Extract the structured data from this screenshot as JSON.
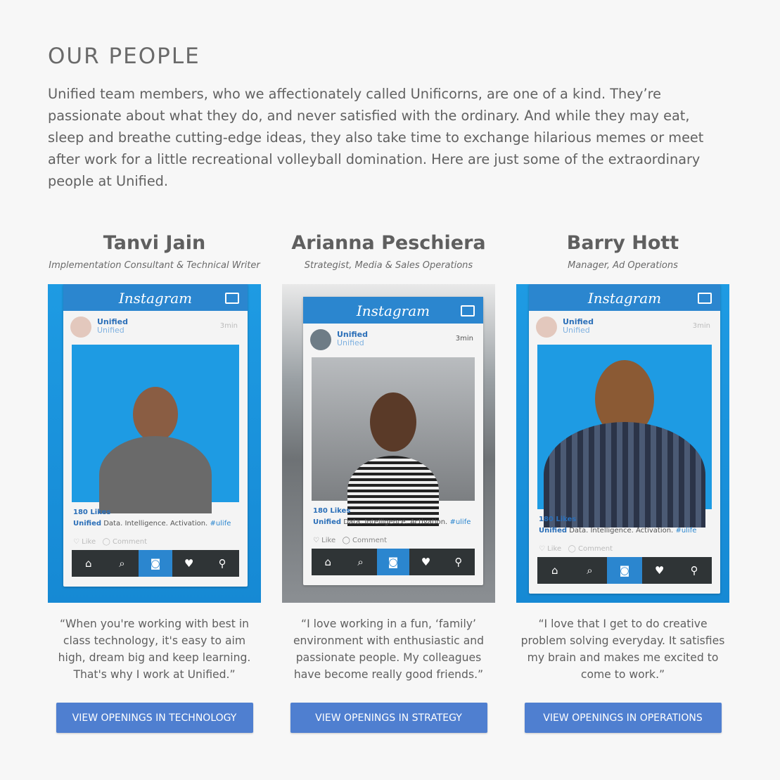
{
  "section": {
    "title": "OUR PEOPLE",
    "intro": "Unified team members, who we affectionately called Unificorns, are one of a kind. They’re passionate about what they do, and never satisfied with the ordinary. And while they may eat, sleep and breathe cutting-edge ideas, they also take time to exchange hilarious memes or meet after work for a little recreational volleyball domination. Here are just some of the extraordinary people at Unified."
  },
  "frame_text": {
    "logo": "Instagram",
    "account": "Unified",
    "account_sub": "Unified",
    "time": "3min",
    "likes": "180 Likes",
    "caption_user": "Unified",
    "caption": "Data. Intelligence. Activation.",
    "hashtag": "#ulife",
    "like": "Like",
    "comment": "Comment",
    "nav_icons": [
      "⌂",
      "⌕",
      "◙",
      "♥",
      "⚲"
    ]
  },
  "people": [
    {
      "name": "Tanvi Jain",
      "role": "Implementation Consultant & Technical Writer",
      "quote": "“When you're working with best in class technology, it's easy to aim high, dream big and keep learning. That's why I work at Unified.”",
      "cta": "VIEW OPENINGS IN TECHNOLOGY"
    },
    {
      "name": "Arianna Peschiera",
      "role": "Strategist, Media & Sales Operations",
      "quote": "“I love working in a fun, ‘family’ environment with enthusiastic and passionate people. My colleagues have become really good friends.”",
      "cta": "VIEW OPENINGS IN STRATEGY"
    },
    {
      "name": "Barry Hott",
      "role": "Manager, Ad Operations",
      "quote": "“I love that I get to do creative problem solving everyday. It satisfies my brain and makes me excited to come to work.”",
      "cta": "VIEW OPENINGS IN OPERATIONS"
    }
  ],
  "colors": {
    "background": "#f7f7f7",
    "button": "#4f7fd0",
    "instagram_blue": "#2b86cf",
    "photo_backdrop": "#1e9be3"
  }
}
